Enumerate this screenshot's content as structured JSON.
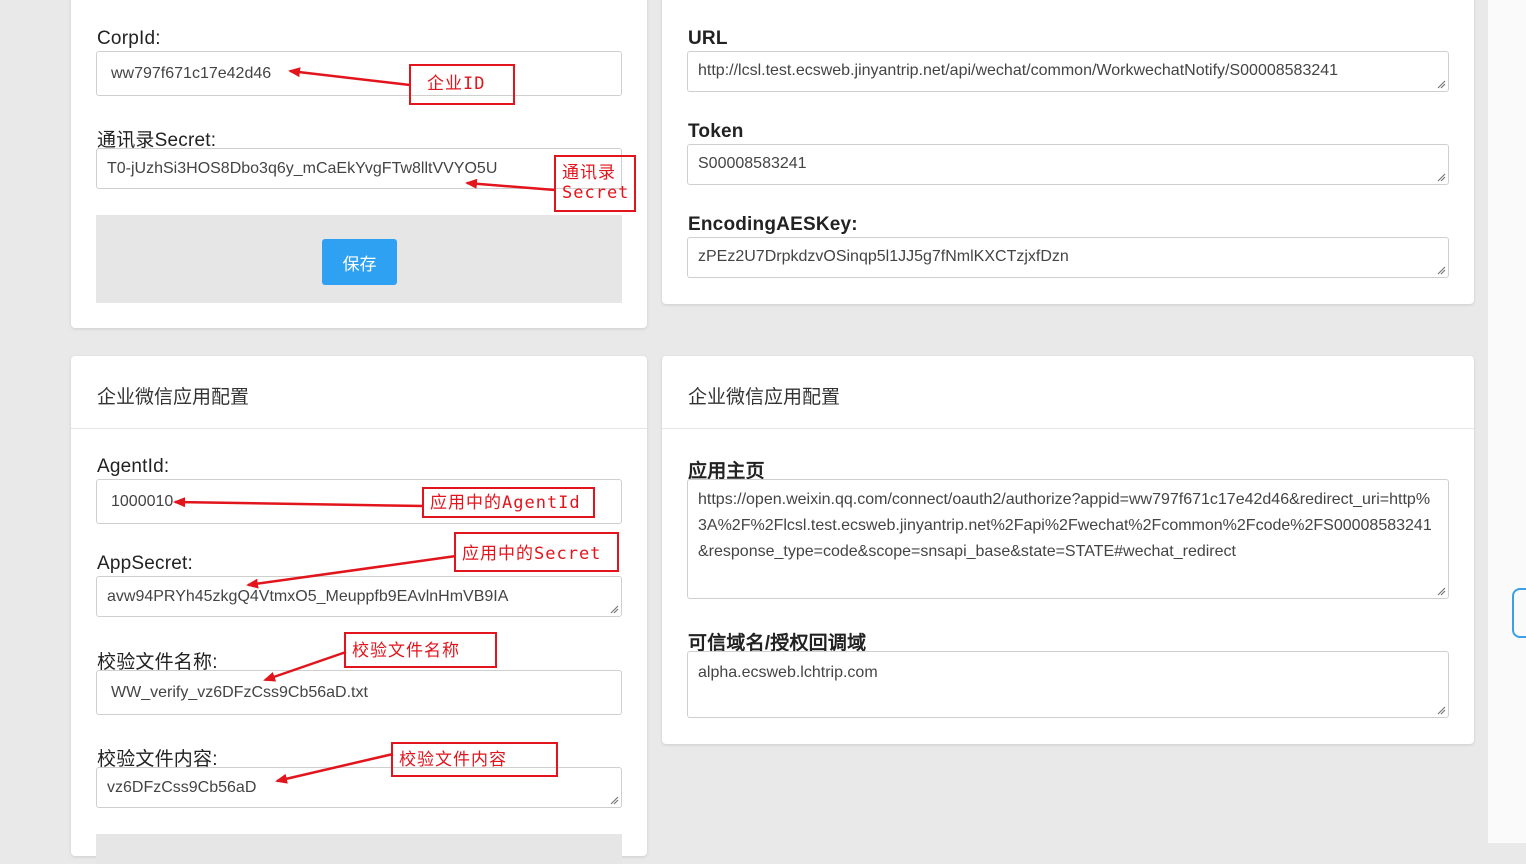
{
  "left_top": {
    "corpid_label": "CorpId:",
    "corpid_value": "ww797f671c17e42d46",
    "secret_label": "通讯录Secret:",
    "secret_value": "T0-jUzhSi3HOS8Dbo3q6y_mCaEkYvgFTw8lltVVYO5U",
    "save_label": "保存"
  },
  "right_top": {
    "url_label": "URL",
    "url_value": "http://lcsl.test.ecsweb.jinyantrip.net/api/wechat/common/WorkwechatNotify/S00008583241",
    "token_label": "Token",
    "token_value": "S00008583241",
    "aes_label": "EncodingAESKey:",
    "aes_value": "zPEz2U7DrpkdzvOSinqp5l1JJ5g7fNmlKXCTzjxfDzn"
  },
  "left_bottom": {
    "title": "企业微信应用配置",
    "agentid_label": "AgentId:",
    "agentid_value": "1000010",
    "appsecret_label": "AppSecret:",
    "appsecret_value": "avw94PRYh45zkgQ4VtmxO5_Meuppfb9EAvlnHmVB9IA",
    "verify_name_label": "校验文件名称:",
    "verify_name_value": "WW_verify_vz6DFzCss9Cb56aD.txt",
    "verify_content_label": "校验文件内容:",
    "verify_content_value": "vz6DFzCss9Cb56aD"
  },
  "right_bottom": {
    "title": "企业微信应用配置",
    "homepage_label": "应用主页",
    "homepage_value": "https://open.weixin.qq.com/connect/oauth2/authorize?appid=ww797f671c17e42d46&redirect_uri=http%3A%2F%2Flcsl.test.ecsweb.jinyantrip.net%2Fapi%2Fwechat%2Fcommon%2Fcode%2FS00008583241&response_type=code&scope=snsapi_base&state=STATE#wechat_redirect",
    "domain_label": "可信域名/授权回调域",
    "domain_value": "alpha.ecsweb.lchtrip.com"
  },
  "annotations": {
    "corpid": "企业ID",
    "secret_line1": "通讯录",
    "secret_line2": "Secret",
    "agentid": "应用中的AgentId",
    "appsecret": "应用中的Secret",
    "verify_name": "校验文件名称",
    "verify_content": "校验文件内容",
    "color": "#e2141c"
  },
  "colors": {
    "button": "#2ea1f3",
    "background": "#e9e9e9"
  }
}
